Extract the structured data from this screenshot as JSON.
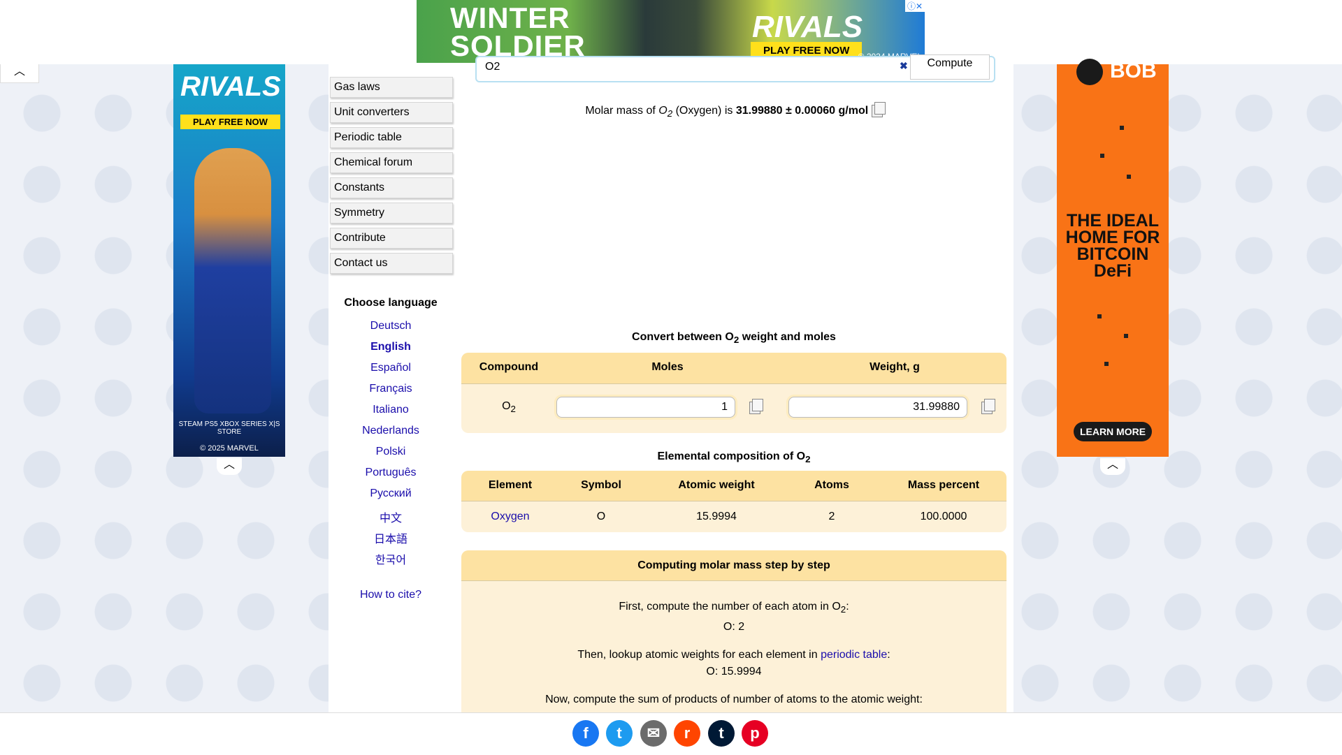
{
  "top_ad": {
    "title_line1": "WINTER",
    "title_line2": "SOLDIER",
    "brand": "RIVALS",
    "cta": "PLAY FREE NOW",
    "copyright": "© 2024 MARVEL",
    "ad_choices": "ⓘ✕"
  },
  "left_ad": {
    "brand": "RIVALS",
    "cta": "PLAY FREE NOW",
    "platforms": "STEAM  PS5  XBOX SERIES X|S  STORE",
    "copyright": "© 2025 MARVEL"
  },
  "right_ad": {
    "logo": "BOB",
    "headline": "THE IDEAL HOME FOR BITCOIN DeFi",
    "cta": "LEARN MORE"
  },
  "nav": {
    "items": [
      "Gas laws",
      "Unit converters",
      "Periodic table",
      "Chemical forum",
      "Constants",
      "Symmetry",
      "Contribute",
      "Contact us"
    ]
  },
  "languages": {
    "heading": "Choose language",
    "items": [
      "Deutsch",
      "English",
      "Español",
      "Français",
      "Italiano",
      "Nederlands",
      "Polski",
      "Português",
      "Русский",
      "中文",
      "日本語",
      "한국어"
    ],
    "cite": "How to cite?"
  },
  "search": {
    "value": "O2",
    "clear": "✖",
    "compute_label": "Compute"
  },
  "result": {
    "prefix": "Molar mass of ",
    "formula": "O",
    "formula_sub": "2",
    "name": " (Oxygen) is ",
    "value": "31.99880 ± 0.00060 g/mol"
  },
  "convert": {
    "title_prefix": "Convert between O",
    "title_sub": "2",
    "title_suffix": " weight and moles",
    "headers": [
      "Compound",
      "Moles",
      "Weight, g"
    ],
    "compound": "O",
    "compound_sub": "2",
    "moles": "1",
    "weight": "31.99880"
  },
  "composition": {
    "title_prefix": "Elemental composition of O",
    "title_sub": "2",
    "headers": [
      "Element",
      "Symbol",
      "Atomic weight",
      "Atoms",
      "Mass percent"
    ],
    "row": [
      "Oxygen",
      "O",
      "15.9994",
      "2",
      "100.0000"
    ]
  },
  "steps": {
    "title": "Computing molar mass step by step",
    "step1_prefix": "First, compute the number of each atom in O",
    "step1_sub": "2",
    "step1_suffix": ":",
    "step1_value": "O: 2",
    "step2_prefix": "Then, lookup atomic weights for each element in ",
    "step2_link": "periodic table",
    "step2_suffix": ":",
    "step2_value": "O: 15.9994",
    "step3": "Now, compute the sum of products of number of atoms to the atomic weight:"
  },
  "share": {
    "facebook": "f",
    "twitter": "t",
    "email": "✉",
    "reddit": "r",
    "tumblr": "t",
    "pinterest": "p"
  }
}
